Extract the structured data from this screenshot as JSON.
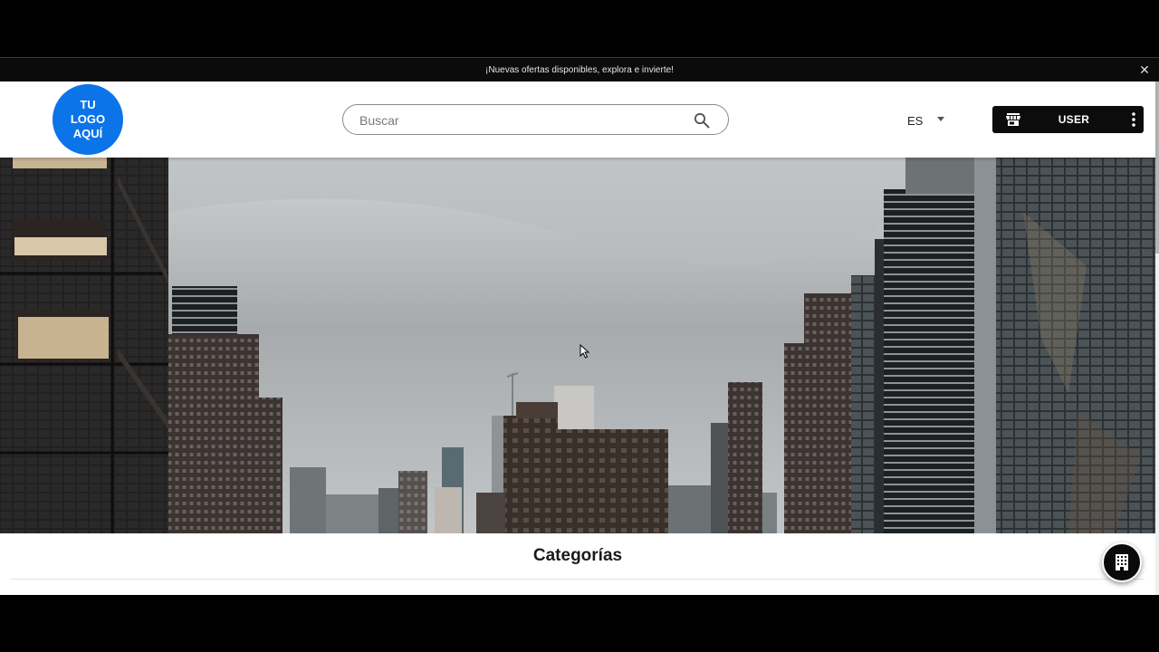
{
  "announcement": {
    "text": "¡Nuevas ofertas disponibles, explora e invierte!",
    "close_icon": "close-icon"
  },
  "header": {
    "logo": {
      "line1": "TU",
      "line2": "LOGO",
      "line3": "AQUÍ",
      "color": "#0a74e8"
    },
    "search": {
      "placeholder": "Buscar",
      "value": "",
      "icon": "search-icon"
    },
    "language": {
      "selected": "ES",
      "icon": "caret-down-icon"
    },
    "user_button": {
      "label": "USER",
      "icon": "store-icon",
      "menu_icon": "more-vertical-icon",
      "color": "#0c0c0c"
    }
  },
  "hero": {
    "image": "city-skyline-photo"
  },
  "categories": {
    "title": "Categorías"
  },
  "fab": {
    "icon": "building-icon"
  }
}
